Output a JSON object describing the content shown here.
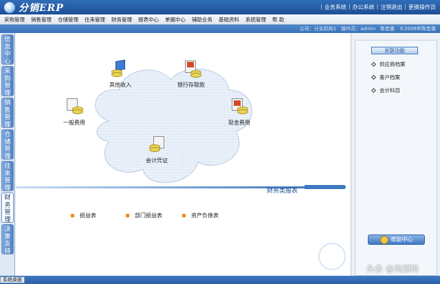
{
  "header": {
    "logo_text": "分销ERP",
    "links": [
      "业务系统",
      "办公系统",
      "注销退出",
      "更换操作员"
    ]
  },
  "menu": [
    "采购管理",
    "销售管理",
    "仓储管理",
    "往来管理",
    "财务管理",
    "报表中心",
    "单据中心",
    "辅助业务",
    "基础资料",
    "系统管理",
    "帮  助"
  ],
  "infobar": {
    "company": "公司：分支机构1",
    "operator": "操作员：admin",
    "user": "陈若愚",
    "copyright": "©2008年陈若愚"
  },
  "left_tabs": [
    "信息中心",
    "采购管理",
    "销售管理",
    "仓储管理",
    "往来管理",
    "财务管理",
    "决策支持"
  ],
  "left_tabs_active": 5,
  "flow_nodes": {
    "other_income": "其他收入",
    "bank_deposit": "银行存取款",
    "general_expense": "一般费用",
    "cash_expense": "现金费用",
    "voucher": "会计凭证"
  },
  "section": {
    "title": "财务类报表"
  },
  "reports": [
    "损益表",
    "部门损益表",
    "资产负债表"
  ],
  "right_panel": {
    "header": "关联功能",
    "items": [
      "供应商档案",
      "客户档案",
      "会计科目"
    ],
    "help": "帮助中心"
  },
  "status": {
    "tab": "系统桌面"
  },
  "watermark": "头条 @淘源码",
  "colors": {
    "accent": "#1d4f97",
    "report_marker": "#f08a1a"
  }
}
